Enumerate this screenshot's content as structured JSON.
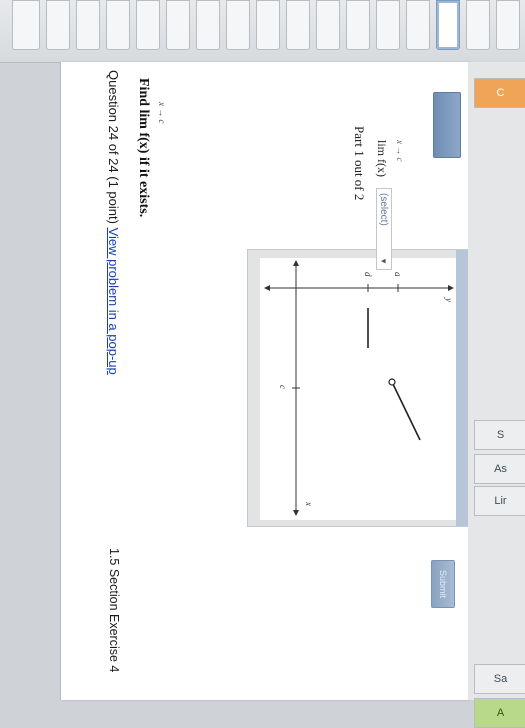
{
  "question": {
    "header_prefix": "Question 24 of 24 (1 point)",
    "view_link": "View problem in a pop-up",
    "section_title": "1.5 Section Exercise 4",
    "prompt": "Find  lim  f(x) if it exists.",
    "prompt_sub": "x → c"
  },
  "part": {
    "label": "Part 1 out of 2",
    "lim_text": "lim  f(x)",
    "lim_sub": "x → c",
    "select_value": "(select)",
    "submit_label": "Submit"
  },
  "graph": {
    "y_axis_label": "y",
    "x_axis_label": "x",
    "tick_a": "a",
    "tick_d": "d",
    "tick_c": "c"
  },
  "right_panel": {
    "buttons": [
      "C",
      "S",
      "As",
      "Lir",
      "Sa",
      "A"
    ]
  },
  "colors": {
    "link": "#1a3fb4",
    "answer_button": "#7f9abf",
    "side_orange": "#f0a457",
    "side_green": "#b8d98a"
  }
}
